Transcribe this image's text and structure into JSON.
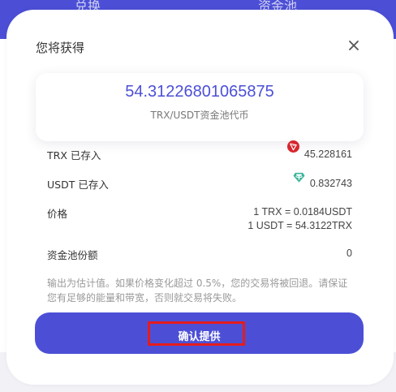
{
  "background": {
    "tab_left": "兑换",
    "tab_right": "资金池",
    "accent_color": "#4c4fd6"
  },
  "modal": {
    "title": "您将获得",
    "close_icon": "close-icon",
    "amount": "54.31226801065875",
    "amount_label": "TRX/USDT资金池代币",
    "rows": {
      "trx_deposited": {
        "label": "TRX 已存入",
        "value": "45.228161",
        "icon": "trx-icon"
      },
      "usdt_deposited": {
        "label": "USDT 已存入",
        "value": "0.832743",
        "icon": "usdt-icon"
      },
      "price": {
        "label": "价格",
        "line1": "1 TRX = 0.0184USDT",
        "line2": "1 USDT = 54.3122TRX"
      },
      "pool_share": {
        "label": "资金池份额",
        "value": "0"
      }
    },
    "notice": "输出为估计值。如果价格变化超过 0.5%，您的交易将被回退。请保证您有足够的能量和带宽，否则就交易将失败。",
    "confirm_label": "确认提供"
  }
}
